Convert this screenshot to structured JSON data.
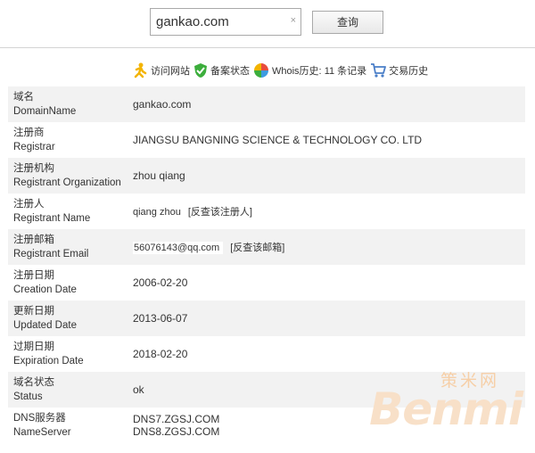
{
  "search": {
    "value": "gankao.com",
    "clear_symbol": "×",
    "button_label": "查询"
  },
  "toolbar": {
    "visit_site": "访问网站",
    "beian": "备案状态",
    "whois_prefix": "Whois历史: ",
    "whois_count": "11",
    "whois_suffix": " 条记录",
    "trade_history": "交易历史",
    "colors": {
      "visit": "#f3b400",
      "beian": "#3cae3c",
      "cart": "#4a7ec8"
    }
  },
  "rows": [
    {
      "label_cn": "域名",
      "label_en": "DomainName",
      "value": "gankao.com"
    },
    {
      "label_cn": "注册商",
      "label_en": "Registrar",
      "value": "JIANGSU BANGNING SCIENCE & TECHNOLOGY CO. LTD"
    },
    {
      "label_cn": "注册机构",
      "label_en": "Registrant Organization",
      "value": "zhou qiang"
    },
    {
      "label_cn": "注册人",
      "label_en": "Registrant Name",
      "value": "qiang zhou",
      "link": "[反查该注册人]"
    },
    {
      "label_cn": "注册邮箱",
      "label_en": "Registrant Email",
      "value": "56076143@qq.com",
      "link": "[反查该邮箱]"
    },
    {
      "label_cn": "注册日期",
      "label_en": "Creation Date",
      "value": "2006-02-20"
    },
    {
      "label_cn": "更新日期",
      "label_en": "Updated Date",
      "value": "2013-06-07"
    },
    {
      "label_cn": "过期日期",
      "label_en": "Expiration Date",
      "value": "2018-02-20"
    },
    {
      "label_cn": "域名状态",
      "label_en": "Status",
      "value": "ok"
    },
    {
      "label_cn": "DNS服务器",
      "label_en": "NameServer",
      "values": [
        "DNS7.ZGSJ.COM",
        "DNS8.ZGSJ.COM"
      ]
    }
  ],
  "watermark": {
    "cn": "策米网",
    "en": "Benmi"
  }
}
